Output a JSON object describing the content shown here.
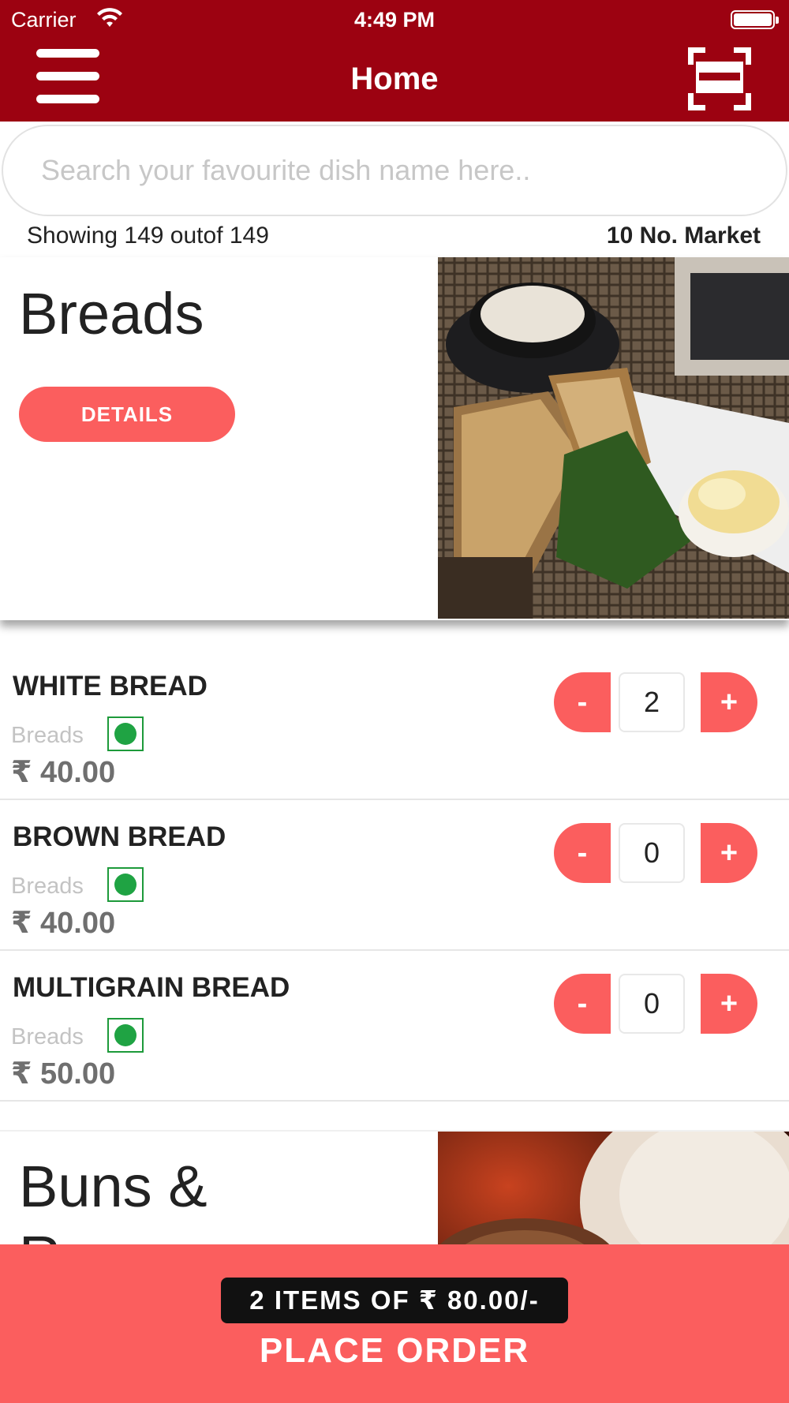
{
  "status_bar": {
    "carrier": "Carrier",
    "time": "4:49 PM"
  },
  "header": {
    "title": "Home",
    "menu_icon": "hamburger-menu-icon",
    "scan_icon": "qr-scan-icon",
    "color": "#9c0211"
  },
  "search": {
    "placeholder": "Search your favourite dish name here..",
    "value": ""
  },
  "info": {
    "showing": "Showing 149 outof 149",
    "market": "10 No. Market"
  },
  "categories": [
    {
      "title": "Breads",
      "details_label": "DETAILS"
    },
    {
      "title": "Buns & Rasses"
    }
  ],
  "items": [
    {
      "name": "WHITE BREAD",
      "category": "Breads",
      "price": "₹ 40.00",
      "qty": "2",
      "minus": "-",
      "plus": "+"
    },
    {
      "name": "BROWN BREAD",
      "category": "Breads",
      "price": "₹ 40.00",
      "qty": "0",
      "minus": "-",
      "plus": "+"
    },
    {
      "name": "MULTIGRAIN BREAD",
      "category": "Breads",
      "price": "₹ 50.00",
      "qty": "0",
      "minus": "-",
      "plus": "+"
    }
  ],
  "order_bar": {
    "summary": "2 ITEMS OF ₹ 80.00/-",
    "action": "PLACE ORDER",
    "color": "#fb5e5e"
  }
}
